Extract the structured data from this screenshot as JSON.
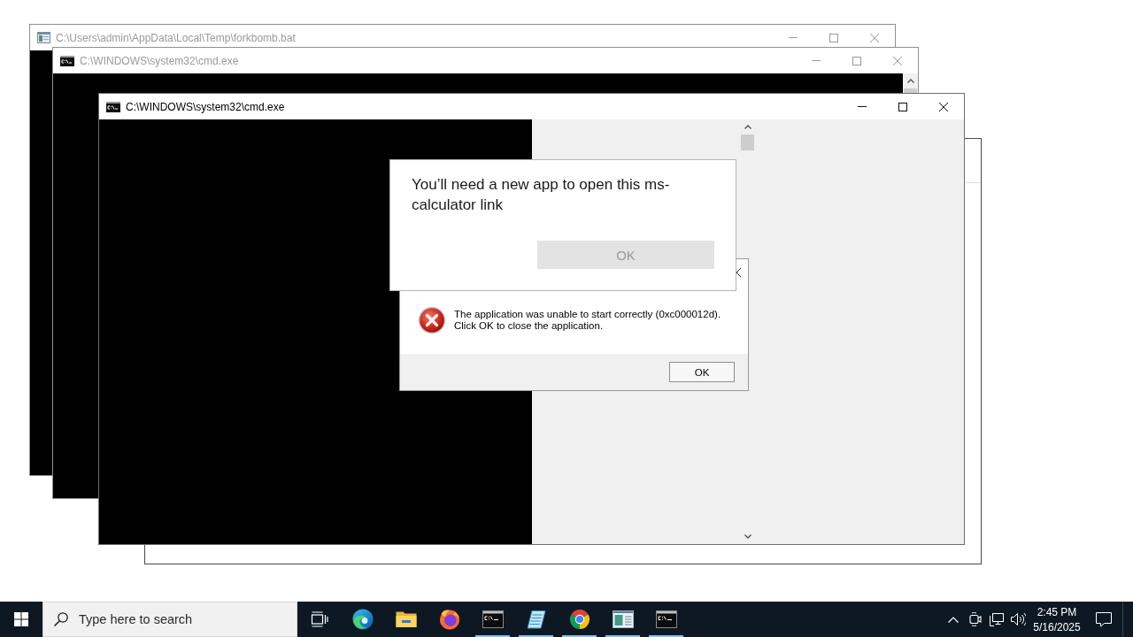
{
  "windows": [
    {
      "kind": "script",
      "title": "C:\\Users\\admin\\AppData\\Local\\Temp\\forkbomb.bat",
      "active": false
    },
    {
      "kind": "console",
      "title": "C:\\WINDOWS\\system32\\cmd.exe",
      "active": false
    },
    {
      "kind": "console",
      "title": "C:\\WINDOWS\\system32\\cmd.exe",
      "active": true
    }
  ],
  "app_prompt": {
    "heading": "You’ll need a new app to open this ms-calculator link",
    "button": {
      "label": "OK",
      "disabled": true
    }
  },
  "error_dialog": {
    "message": "The application was unable to start correctly (0xc000012d).\nClick OK to close the application.",
    "button": "OK"
  },
  "taskbar": {
    "search": {
      "placeholder": "Type here to search"
    },
    "apps": [
      {
        "kind": "edge",
        "running": false
      },
      {
        "kind": "explorer",
        "running": false
      },
      {
        "kind": "firefox",
        "running": false
      },
      {
        "kind": "console",
        "running": true
      },
      {
        "kind": "notepad",
        "running": true
      },
      {
        "kind": "chrome",
        "running": true
      },
      {
        "kind": "viewer",
        "running": true
      },
      {
        "kind": "console",
        "running": true
      }
    ],
    "tray": {
      "time": "2:45 PM",
      "date": "5/16/2025"
    }
  }
}
